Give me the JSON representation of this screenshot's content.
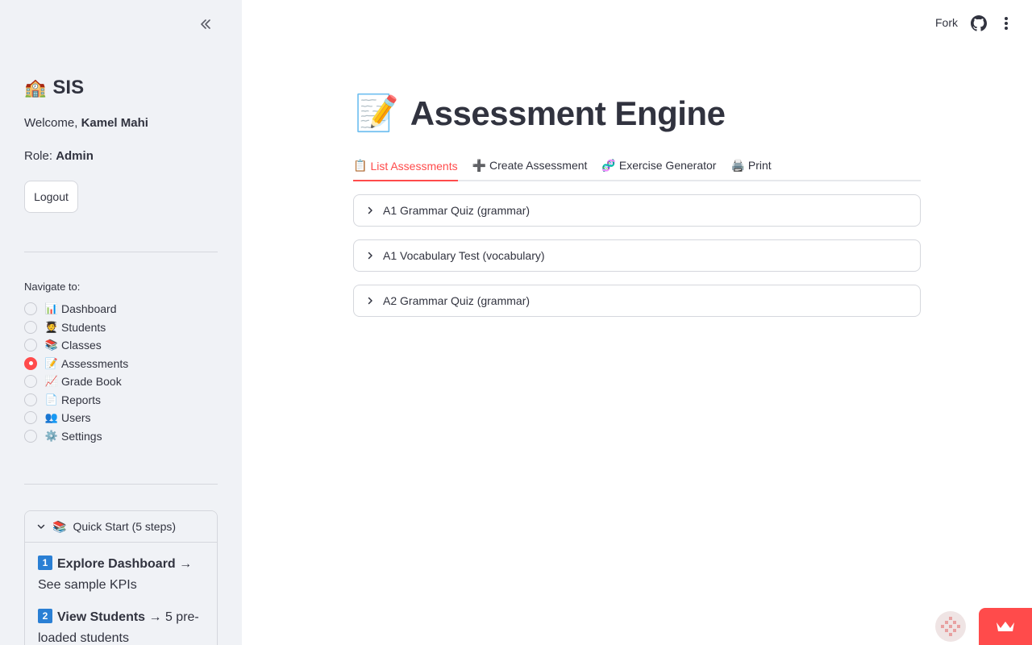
{
  "sidebar": {
    "brand_emoji": "🏫",
    "brand_title": "SIS",
    "welcome_prefix": "Welcome, ",
    "user_name": "Kamel Mahi",
    "role_prefix": "Role: ",
    "role": "Admin",
    "logout_label": "Logout",
    "nav_label": "Navigate to:",
    "nav_items": [
      {
        "emoji": "📊",
        "label": "Dashboard",
        "selected": false
      },
      {
        "emoji": "🧑‍🎓",
        "label": "Students",
        "selected": false
      },
      {
        "emoji": "📚",
        "label": "Classes",
        "selected": false
      },
      {
        "emoji": "📝",
        "label": "Assessments",
        "selected": true
      },
      {
        "emoji": "📈",
        "label": "Grade Book",
        "selected": false
      },
      {
        "emoji": "📄",
        "label": "Reports",
        "selected": false
      },
      {
        "emoji": "👥",
        "label": "Users",
        "selected": false
      },
      {
        "emoji": "⚙️",
        "label": "Settings",
        "selected": false
      }
    ],
    "quickstart": {
      "emoji": "📚",
      "title": "Quick Start (5 steps)",
      "steps": [
        {
          "num": "1",
          "bold": "Explore Dashboard",
          "rest": " → See sample KPIs"
        },
        {
          "num": "2",
          "bold": "View Students",
          "rest": " → 5 pre-loaded students"
        }
      ]
    }
  },
  "header": {
    "fork_label": "Fork"
  },
  "main": {
    "title_emoji": "📝",
    "title": "Assessment Engine",
    "tabs": [
      {
        "emoji": "📋",
        "label": "List Assessments",
        "active": true
      },
      {
        "emoji": "➕",
        "label": "Create Assessment",
        "active": false
      },
      {
        "emoji": "🧬",
        "label": "Exercise Generator",
        "active": false
      },
      {
        "emoji": "🖨️",
        "label": "Print",
        "active": false
      }
    ],
    "assessments": [
      "A1 Grammar Quiz (grammar)",
      "A1 Vocabulary Test (vocabulary)",
      "A2 Grammar Quiz (grammar)"
    ]
  },
  "colors": {
    "accent": "#ff4b4b",
    "sidebar_bg": "#f0f2f6",
    "text": "#31333f",
    "border": "#d5d7dd"
  }
}
